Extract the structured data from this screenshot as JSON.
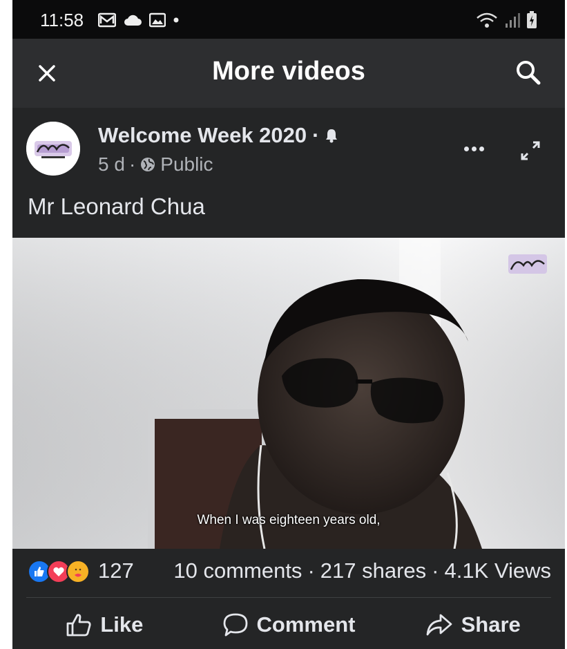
{
  "status_bar": {
    "time": "11:58"
  },
  "header": {
    "title": "More videos",
    "icons": {
      "close": "close-icon",
      "search": "search-icon"
    }
  },
  "post": {
    "page_name": "Welcome Week 2020",
    "page_name_separator": "·",
    "time_ago": "5 d",
    "meta_separator": "·",
    "audience": "Public",
    "caption": "Mr Leonard Chua",
    "video": {
      "subtitle": "When I was eighteen years old,"
    }
  },
  "stats": {
    "reaction_count": "127",
    "comments": "10 comments",
    "sep1": "·",
    "shares": "217 shares",
    "sep2": "·",
    "views": "4.1K Views",
    "reaction_icons": [
      "like-reaction-icon",
      "love-reaction-icon",
      "care-reaction-icon"
    ]
  },
  "actions": {
    "like": "Like",
    "comment": "Comment",
    "share": "Share"
  },
  "colors": {
    "background": "#242526",
    "header": "#2d2e30",
    "text": "#e4e6eb",
    "secondary_text": "#b0b3b8",
    "like_blue": "#1877f2",
    "love_red": "#f33e58",
    "care_yellow": "#f7b125"
  }
}
